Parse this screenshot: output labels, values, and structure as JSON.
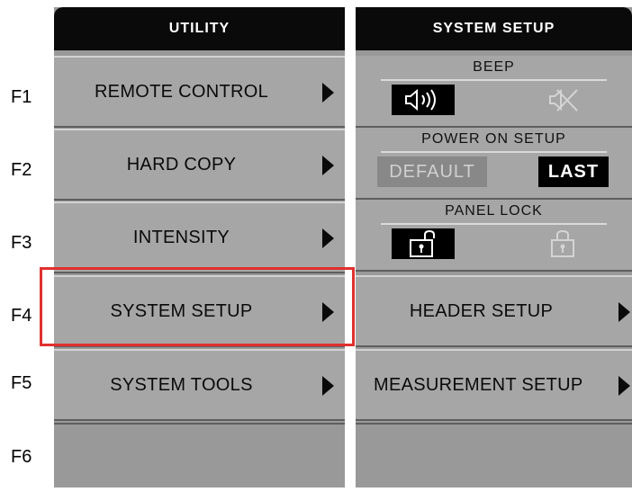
{
  "function_keys": [
    "F1",
    "F2",
    "F3",
    "F4",
    "F5",
    "F6"
  ],
  "utility_menu": {
    "title": "UTILITY",
    "items": [
      {
        "label": "REMOTE CONTROL"
      },
      {
        "label": "HARD COPY"
      },
      {
        "label": "INTENSITY"
      },
      {
        "label": "SYSTEM SETUP"
      },
      {
        "label": "SYSTEM TOOLS"
      }
    ]
  },
  "system_setup": {
    "title": "SYSTEM SETUP",
    "beep": {
      "label": "BEEP",
      "options": [
        "sound-on-icon",
        "sound-off-icon"
      ],
      "selected": "sound-on-icon"
    },
    "power_on_setup": {
      "label": "POWER ON SETUP",
      "options": [
        "DEFAULT",
        "LAST"
      ],
      "selected": "LAST"
    },
    "panel_lock": {
      "label": "PANEL LOCK",
      "options": [
        "unlocked-icon",
        "locked-icon"
      ],
      "selected": "unlocked-icon"
    },
    "items": [
      {
        "label": "HEADER SETUP"
      },
      {
        "label": "MEASUREMENT SETUP"
      }
    ]
  },
  "colors": {
    "header": "#0a0a0a",
    "button": "#a6a6a6",
    "highlight": "#e03030"
  }
}
